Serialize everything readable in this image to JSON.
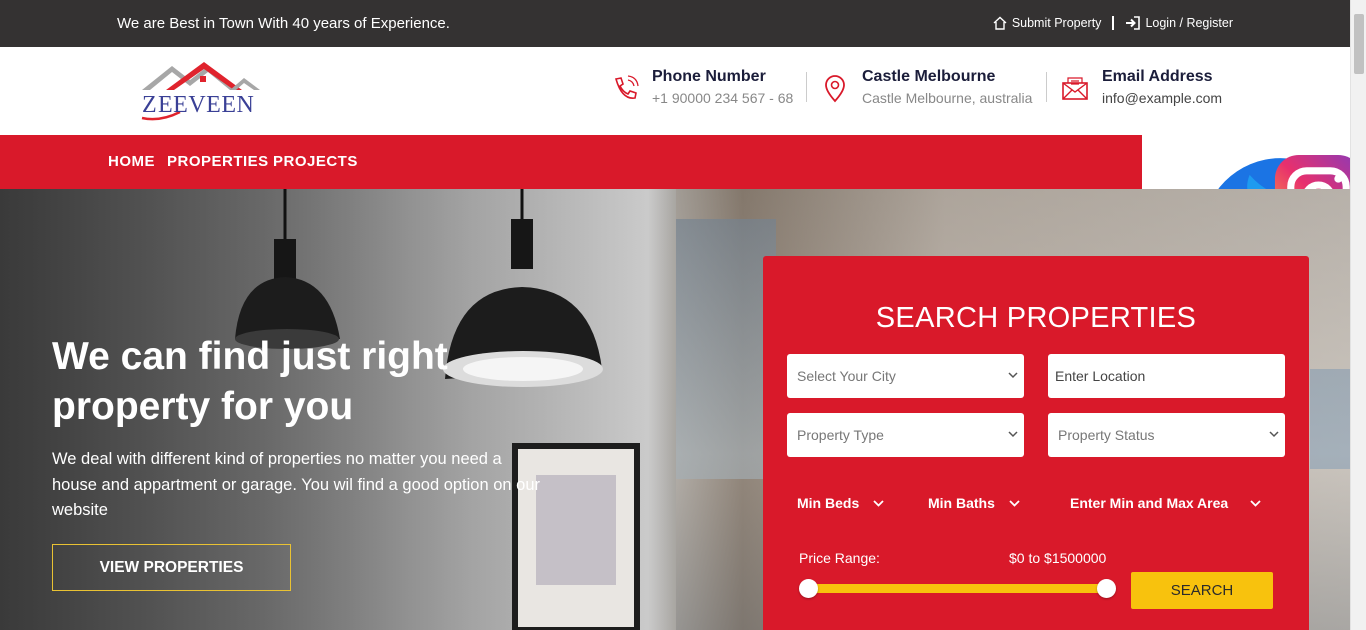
{
  "topbar": {
    "tagline": "We are Best in Town With 40 years of Experience.",
    "submit_label": "Submit Property",
    "login_label": "Login / Register",
    "icons": [
      "home-icon",
      "login-icon"
    ]
  },
  "logo": {
    "text": "EEVEEN"
  },
  "contacts": [
    {
      "title": "Phone Number",
      "sub": "+1 90000 234 567 - 68",
      "icon": "phone-icon"
    },
    {
      "title": "Castle Melbourne",
      "sub": "Castle Melbourne, australia",
      "icon": "map-pin-icon"
    },
    {
      "title": "Email Address",
      "sub": "info@example.com",
      "icon": "envelope-icon"
    }
  ],
  "nav": {
    "items": [
      "HOME",
      "PROPERTIES",
      "PROJECTS"
    ]
  },
  "social": [
    "facebook-icon",
    "twitter-icon",
    "instagram-icon"
  ],
  "hero": {
    "heading": "We can find just right property for you",
    "description": "We deal with different kind of properties no matter you need a house and appartment or garage. You wil find a good option on our website",
    "button_label": "VIEW PROPERTIES"
  },
  "search": {
    "title": "SEARCH PROPERTIES",
    "city_placeholder": "Select Your City",
    "location_placeholder": "Enter Location",
    "type_placeholder": "Property Type",
    "status_placeholder": "Property Status",
    "min_beds": "Min Beds",
    "min_baths": "Min Baths",
    "area": "Enter Min and Max Area",
    "price_label": "Price Range:",
    "price_value": "$0 to $1500000",
    "button_label": "SEARCH"
  },
  "colors": {
    "brand_red": "#d9192a",
    "accent_yellow": "#f8c20d",
    "topbar": "#343232"
  }
}
